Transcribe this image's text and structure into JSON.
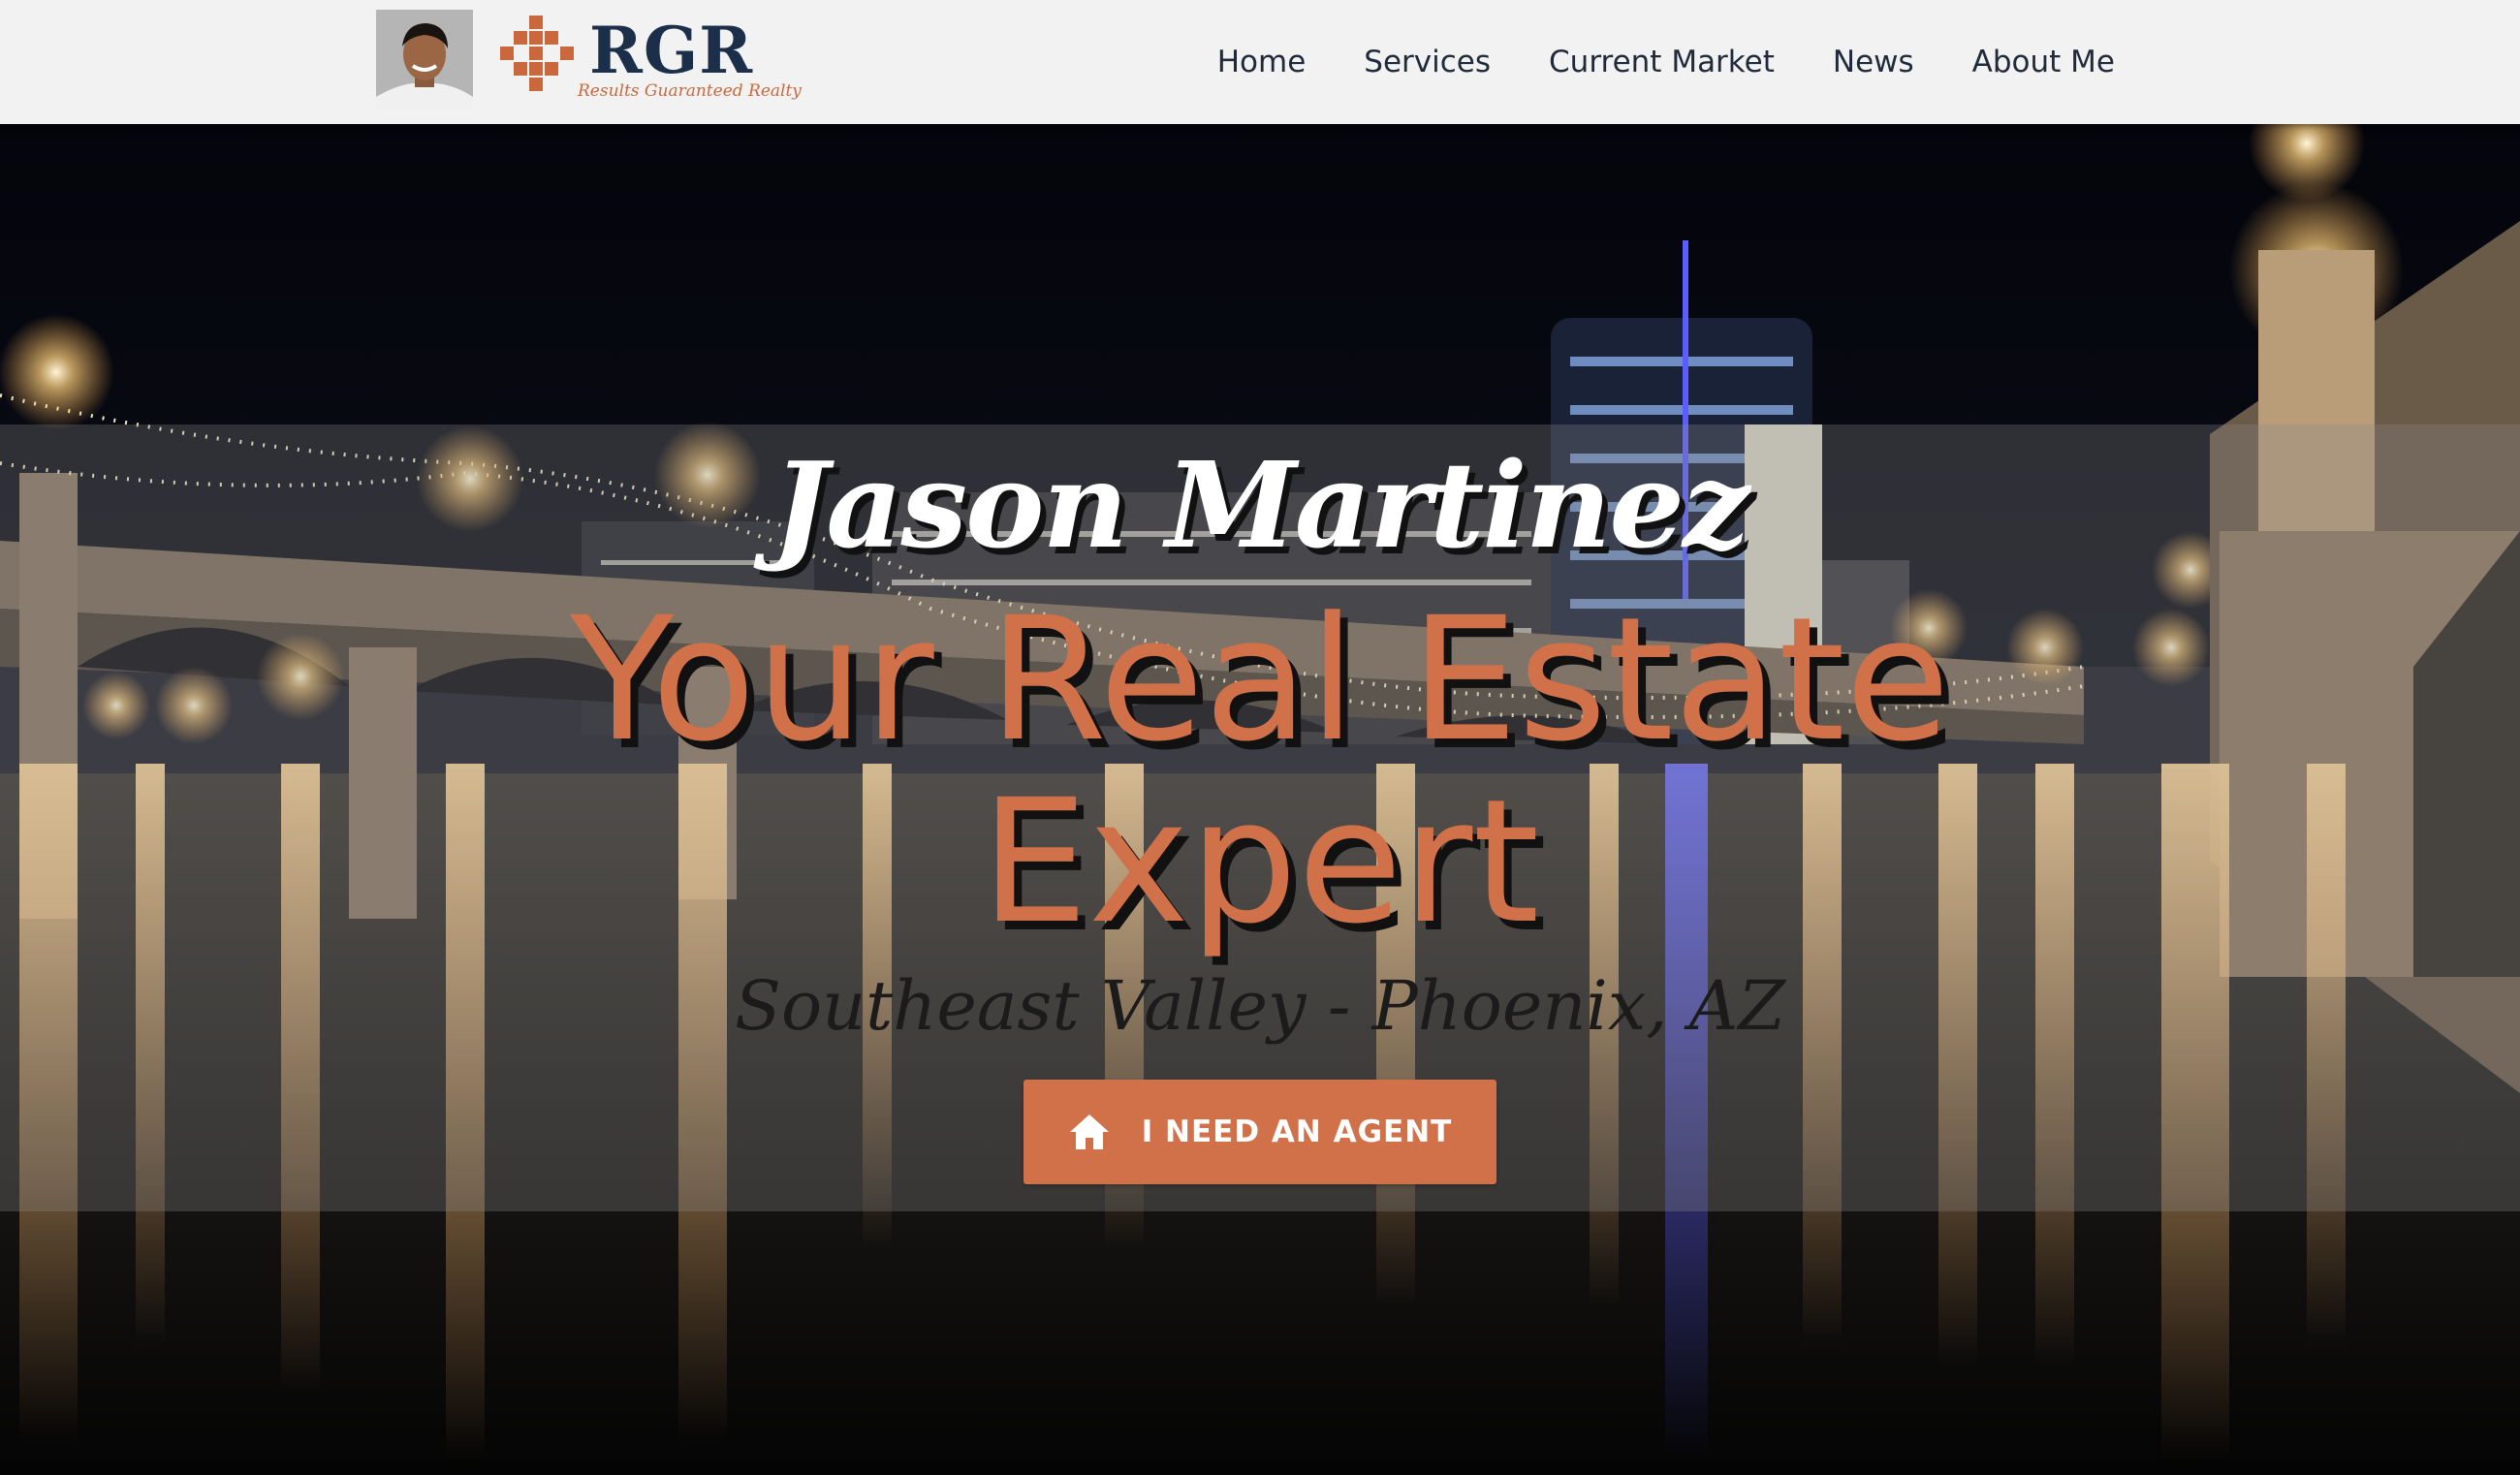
{
  "header": {
    "logo": {
      "letters": "RGR",
      "tagline": "Results Guaranteed Realty"
    },
    "nav": [
      {
        "label": "Home"
      },
      {
        "label": "Services"
      },
      {
        "label": "Current Market"
      },
      {
        "label": "News"
      },
      {
        "label": "About Me"
      }
    ]
  },
  "hero": {
    "agent_name": "Jason Martinez",
    "headline_line1": "Your Real Estate",
    "headline_line2": "Expert",
    "subtitle": "Southeast Valley - Phoenix, AZ",
    "cta": {
      "label": "I NEED AN AGENT",
      "icon": "home-icon"
    }
  },
  "colors": {
    "accent": "#d0714a",
    "header_bg": "#f2f2f2",
    "logo_navy": "#1c2f4a",
    "nav_text": "#1f2a3a"
  }
}
